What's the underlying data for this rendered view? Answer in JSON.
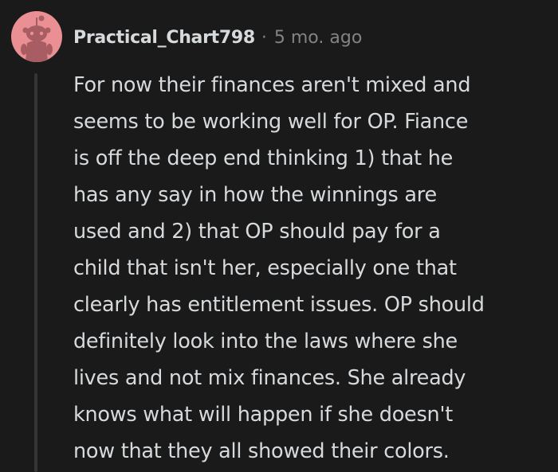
{
  "comment": {
    "avatar": "snoo-avatar-icon",
    "username": "Practical_Chart798",
    "separator": "·",
    "timestamp": "5 mo. ago",
    "body_lines": [
      "For now their finances aren't mixed and",
      "seems to be working well for OP. Fiance",
      "is off the deep end thinking 1) that he",
      "has any say in how the winnings are",
      "used and 2) that OP should pay for a",
      "child that isn't her, especially one that",
      "clearly has entitlement issues. OP should",
      "definitely look into the laws where she",
      "lives and not mix finances. She already",
      "knows what will happen if she doesn't",
      "now that they all showed their colors."
    ]
  },
  "colors": {
    "background": "#1a1a1b",
    "avatar_bg": "#ea8f94",
    "text_primary": "#d7dadc",
    "text_secondary": "#818384",
    "thread_line": "#343536"
  }
}
